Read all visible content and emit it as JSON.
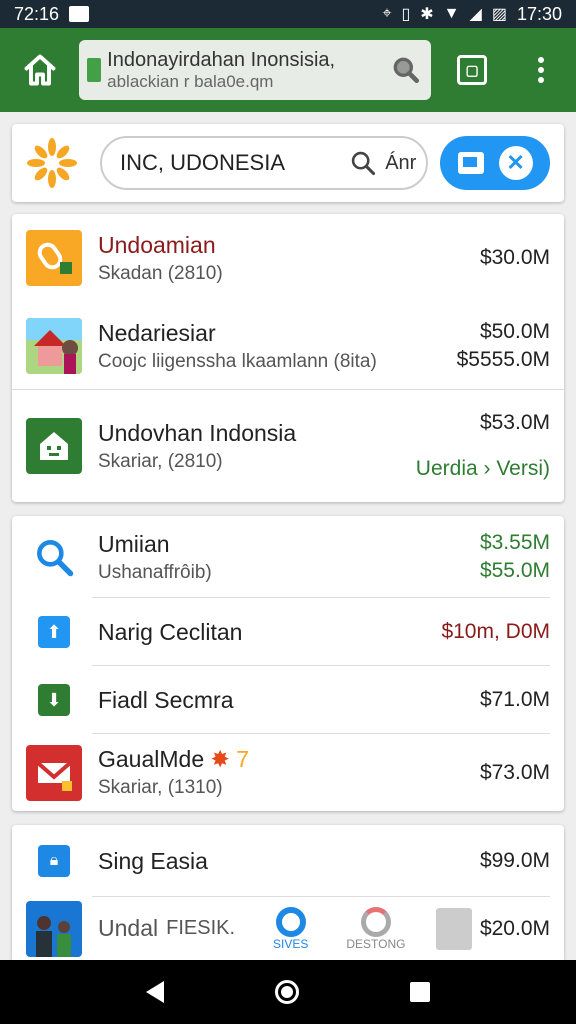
{
  "status_bar": {
    "time_left": "72:16",
    "time_right": "17:30"
  },
  "browser": {
    "url_line1": "Indonayirdahan Inonsisia,",
    "url_line2": "ablackian r bala0e.qm"
  },
  "search": {
    "query": "INC, UDONESIA",
    "suffix": "Ánr"
  },
  "group1": [
    {
      "title": "Undoamian",
      "sub": "Skadan (2810)",
      "right1": "$30.0M",
      "right2": "",
      "title_color": "#8b1a1a"
    },
    {
      "title": "Nedariesiar",
      "sub": "Coojc liigenssha lkaamlann (8ita)",
      "right1": "$50.0M",
      "right2": "$5555.0M",
      "right2_color": "#2e7d32"
    },
    {
      "title": "Undovhan Indonsia",
      "sub": "Skariar, (2810)",
      "right1": "$53.0M",
      "right2": "Uerdia › Versi)",
      "right2_color": "#2e7d32"
    }
  ],
  "group2": [
    {
      "title": "Umiian",
      "sub": "Ushanaffrôib)",
      "right1": "$3.55M",
      "right2": "$55.0M",
      "right1_color": "#2e7d32",
      "right2_color": "#2e7d32"
    },
    {
      "title": "Narig Ceclitan",
      "sub": "",
      "right1": "$10m, D0M",
      "right1_color": "#8b1a1a"
    },
    {
      "title": "Fiadl Secmra",
      "sub": "",
      "right1": "$71.0M"
    },
    {
      "title": "GaualMde",
      "title_suffix": "7",
      "sub": "Skariar, (1310)",
      "right1": "$73.0M"
    }
  ],
  "group3": [
    {
      "title": "Sing Easia",
      "right1": "$99.0M"
    },
    {
      "title": "Undal",
      "title_suffix": "FIESIK.",
      "right1": "$20.0M",
      "tab1": "SIVES",
      "tab2": "DESTONG"
    }
  ]
}
